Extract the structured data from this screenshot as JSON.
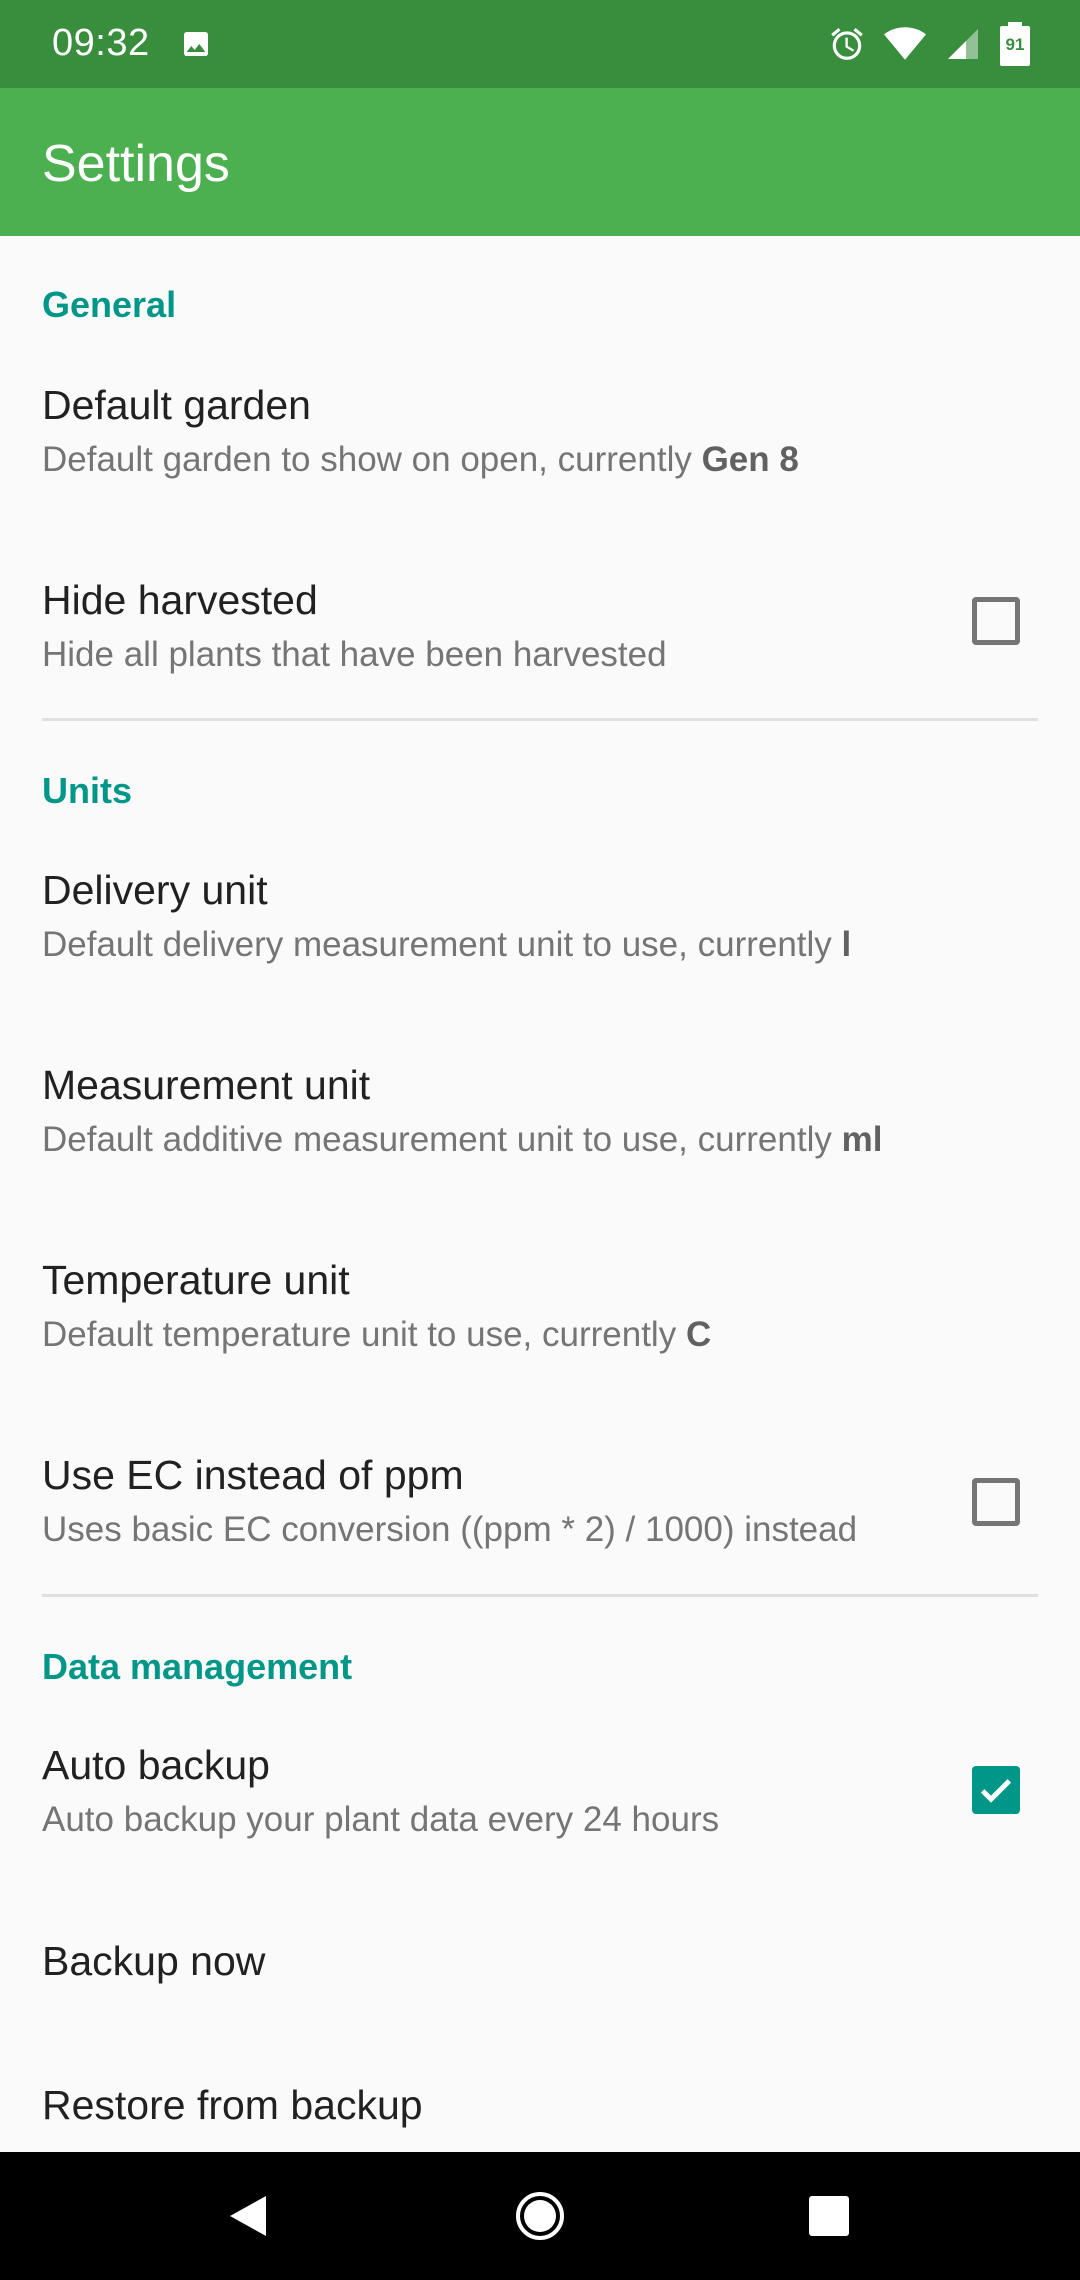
{
  "status_bar": {
    "time": "09:32",
    "battery": "91",
    "icons": [
      "image-icon",
      "alarm-icon",
      "wifi-icon",
      "signal-icon",
      "battery-icon"
    ]
  },
  "app_bar": {
    "title": "Settings"
  },
  "sections": {
    "general": {
      "header": "General",
      "default_garden": {
        "title": "Default garden",
        "summary_prefix": "Default garden to show on open, currently ",
        "summary_value": "Gen 8"
      },
      "hide_harvested": {
        "title": "Hide harvested",
        "summary": "Hide all plants that have been harvested",
        "checked": false
      }
    },
    "units": {
      "header": "Units",
      "delivery_unit": {
        "title": "Delivery unit",
        "summary_prefix": "Default delivery measurement unit to use, currently ",
        "summary_value": "l"
      },
      "measurement_unit": {
        "title": "Measurement unit",
        "summary_prefix": "Default additive measurement unit to use, currently ",
        "summary_value": "ml"
      },
      "temperature_unit": {
        "title": "Temperature unit",
        "summary_prefix": "Default temperature unit to use, currently ",
        "summary_value": "C"
      },
      "use_ec": {
        "title": "Use EC instead of ppm",
        "summary": "Uses basic EC conversion ((ppm * 2) / 1000) instead",
        "checked": false
      }
    },
    "data_management": {
      "header": "Data management",
      "auto_backup": {
        "title": "Auto backup",
        "summary": "Auto backup your plant data every 24 hours",
        "checked": true
      },
      "backup_now": {
        "title": "Backup now"
      },
      "restore": {
        "title": "Restore from backup"
      }
    }
  },
  "colors": {
    "status_bar": "#388e3c",
    "app_bar": "#4caf50",
    "accent": "#009688"
  },
  "nav_bar": {
    "icons": [
      "back-icon",
      "home-icon",
      "recents-icon"
    ]
  }
}
